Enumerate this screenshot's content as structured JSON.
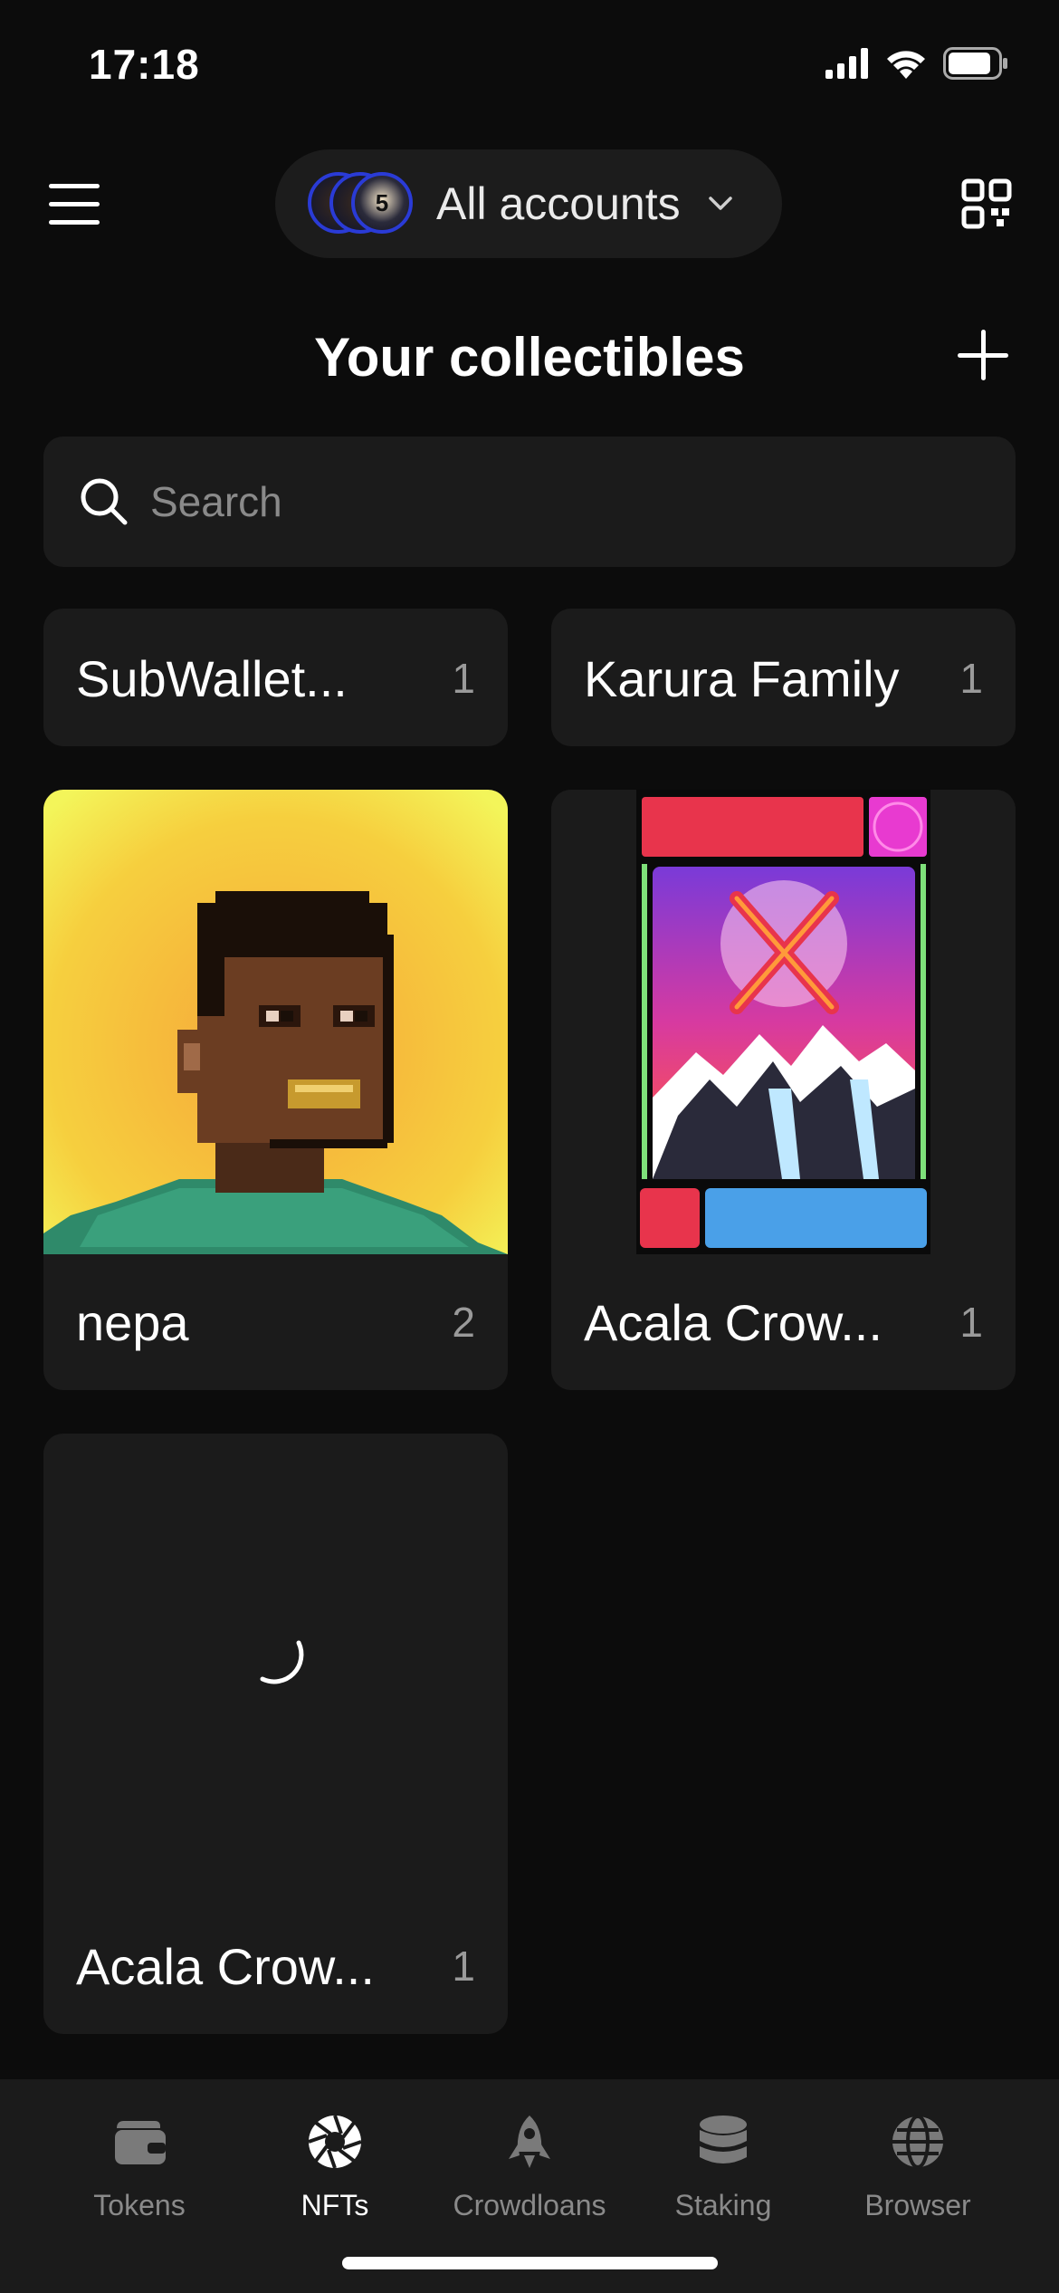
{
  "status_bar": {
    "time": "17:18"
  },
  "header": {
    "account_label": "All accounts",
    "account_badge": "5"
  },
  "page": {
    "title": "Your collectibles"
  },
  "search": {
    "placeholder": "Search"
  },
  "collections": [
    {
      "name": "SubWallet...",
      "count": "1"
    },
    {
      "name": "Karura Family",
      "count": "1"
    },
    {
      "name": "nepa",
      "count": "2"
    },
    {
      "name": "Acala Crow...",
      "count": "1"
    },
    {
      "name": "Acala Crow...",
      "count": "1"
    }
  ],
  "nav": [
    {
      "label": "Tokens",
      "icon": "wallet-icon"
    },
    {
      "label": "NFTs",
      "icon": "aperture-icon",
      "active": true
    },
    {
      "label": "Crowdloans",
      "icon": "rocket-icon"
    },
    {
      "label": "Staking",
      "icon": "database-icon"
    },
    {
      "label": "Browser",
      "icon": "globe-icon"
    }
  ],
  "colors": {
    "background": "#0c0c0c",
    "card": "#1b1b1b",
    "muted": "#8a8a8a"
  }
}
